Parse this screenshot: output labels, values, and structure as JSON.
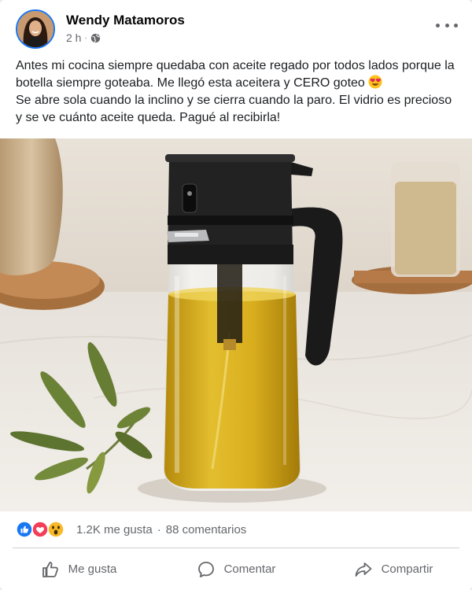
{
  "post": {
    "author": "Wendy Matamoros",
    "time": "2 h",
    "dot": "·",
    "text": "Antes mi cocina siempre quedaba con aceite regado por todos lados porque la botella siempre goteaba. Me llegó esta aceitera y CERO goteo",
    "text_after_emoji": "Se abre sola cuando la inclino y se cierra cuando la paro. El vidrio es precioso y se ve cuánto aceite queda. Pagué al recibirla!",
    "emoji_icon": "heart-eyes-emoji-icon",
    "privacy_icon": "globe-icon",
    "image_icon": "oil-dispenser-photo"
  },
  "stats": {
    "likes": "1.2K me gusta",
    "separator": "·",
    "comments": "88 comentarios",
    "reaction_icons": [
      "like-reaction-icon",
      "love-reaction-icon",
      "wow-reaction-icon"
    ]
  },
  "actions": {
    "like": "Me gusta",
    "comment": "Comentar",
    "share": "Compartir"
  },
  "colors": {
    "brand_blue": "#1877f2",
    "secondary_text": "#65676b",
    "love_red": "#f33e58",
    "wow_yellow": "#f7b928"
  }
}
